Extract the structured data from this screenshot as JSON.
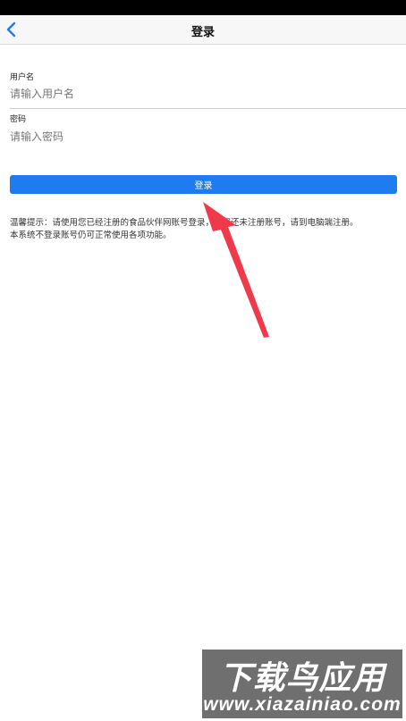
{
  "nav": {
    "title": "登录",
    "back_icon": "chevron-left-icon"
  },
  "form": {
    "username_label": "用户名",
    "username_placeholder": "请输入用户名",
    "password_label": "密码",
    "password_placeholder": "请输入密码",
    "login_button": "登录"
  },
  "tip": {
    "line1": "温馨提示：请使用您已经注册的食品伙伴网账号登录，若您还未注册账号，请到电脑端注册。",
    "line2": "本系统不登录账号仍可正常使用各项功能。"
  },
  "watermark": {
    "title": "下载鸟应用",
    "url": "www.xiazainiao.com"
  },
  "colors": {
    "accent": "#1e7cf0",
    "annotation_arrow": "#f03a4c",
    "nav_bg": "#f7f7f7"
  }
}
